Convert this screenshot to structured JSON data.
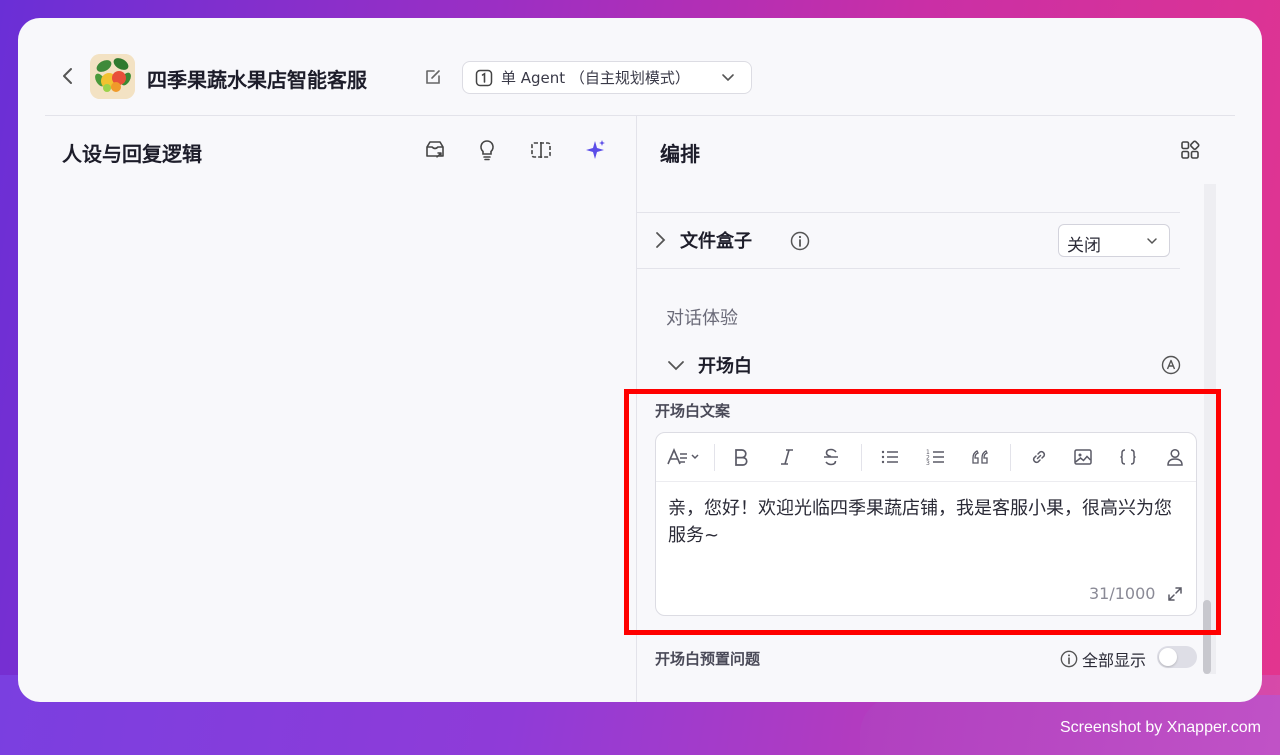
{
  "header": {
    "app_title": "四季果蔬水果店智能客服",
    "mode_label": "单 Agent （自主规划模式）"
  },
  "left_panel": {
    "title": "人设与回复逻辑"
  },
  "right_panel": {
    "title": "编排",
    "file_box": {
      "label": "文件盒子",
      "select_value": "关闭"
    },
    "section_dialog": "对话体验",
    "opening": {
      "label": "开场白",
      "text_field_label": "开场白文案",
      "text": "亲，您好！欢迎光临四季果蔬店铺，我是客服小果，很高兴为您服务~",
      "counter": "31/1000",
      "preset_questions_label": "开场白预置问题",
      "show_all_label": "全部显示",
      "show_all_on": false
    }
  },
  "toolbar_icons": [
    "text-style-icon",
    "bold-icon",
    "italic-icon",
    "strikethrough-icon",
    "bullet-list-icon",
    "numbered-list-icon",
    "quote-icon",
    "link-icon",
    "image-icon",
    "braces-icon",
    "person-icon"
  ],
  "watermark": "Screenshot by Xnapper.com",
  "colors": {
    "accent": "#5b4de8",
    "highlight": "#ff0000"
  }
}
